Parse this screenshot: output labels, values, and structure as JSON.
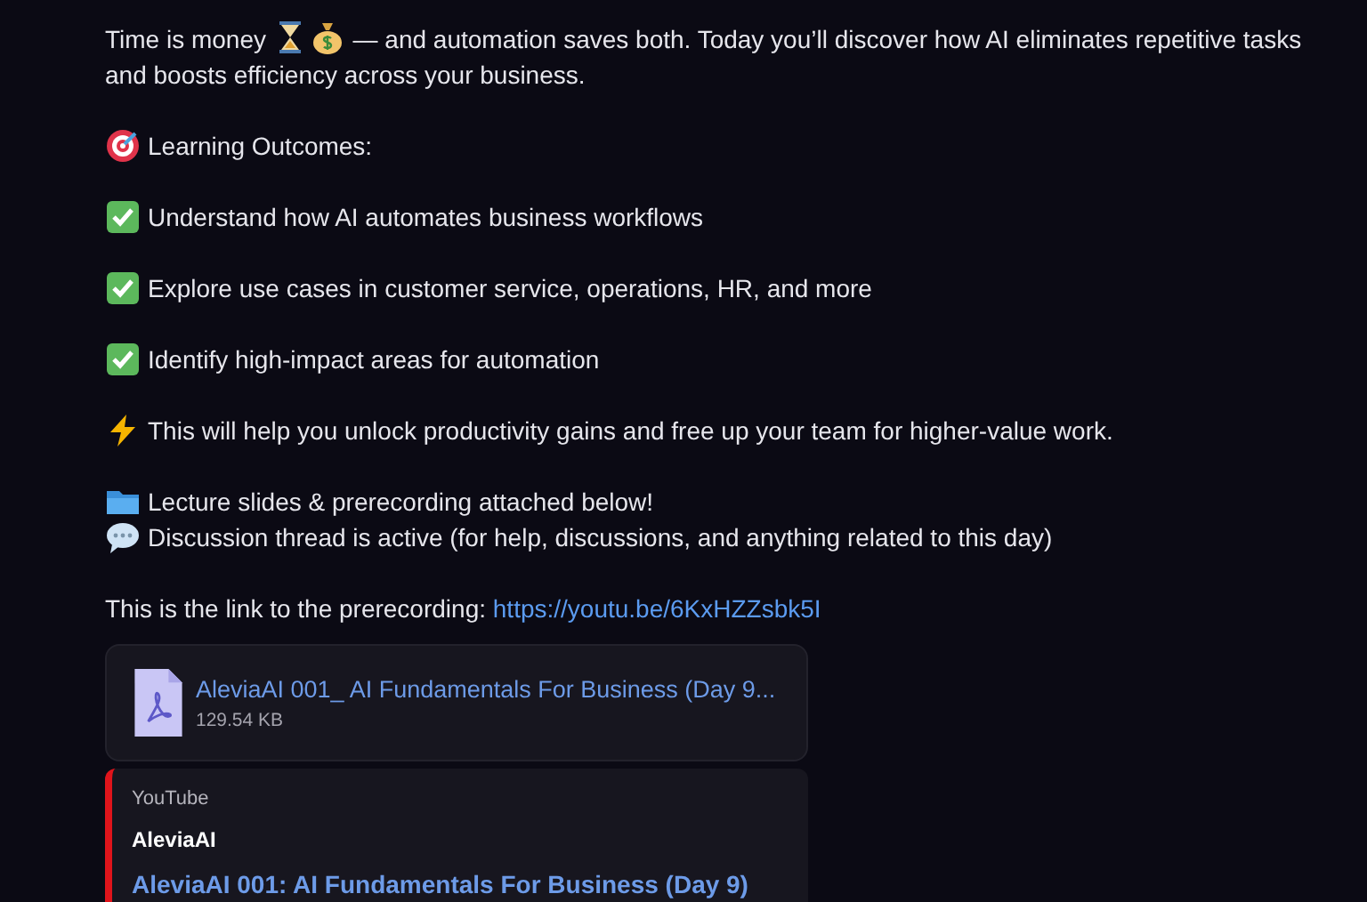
{
  "intro": {
    "before": "Time is money",
    "after": "— and automation saves both. Today you’ll discover how AI eliminates repetitive tasks and boosts efficiency across your business."
  },
  "paragraphs": [
    {
      "lines": [
        {
          "kind": "target",
          "text": "Learning Outcomes:"
        }
      ]
    },
    {
      "lines": [
        {
          "kind": "check",
          "text": "Understand how AI automates business workflows"
        }
      ]
    },
    {
      "lines": [
        {
          "kind": "check",
          "text": "Explore use cases in customer service, operations, HR, and more"
        }
      ]
    },
    {
      "lines": [
        {
          "kind": "check",
          "text": "Identify high-impact areas for automation"
        }
      ]
    },
    {
      "lines": [
        {
          "kind": "bolt",
          "text": "This will help you unlock productivity gains and free up your team for higher-value work."
        }
      ]
    },
    {
      "lines": [
        {
          "kind": "folder",
          "text": "Lecture slides & prerecording attached below!"
        },
        {
          "kind": "speech",
          "text": "Discussion thread is active (for help, discussions, and anything related to this day)"
        }
      ]
    }
  ],
  "link_line": {
    "text": "This is the link to the prerecording:",
    "url": "https://youtu.be/6KxHZZsbk5I"
  },
  "attachment": {
    "name": "AleviaAI 001_ AI Fundamentals For Business (Day 9...",
    "size": "129.54 KB"
  },
  "embed": {
    "provider": "YouTube",
    "author": "AleviaAI",
    "title": "AleviaAI 001: AI Fundamentals For Business (Day 9)"
  }
}
